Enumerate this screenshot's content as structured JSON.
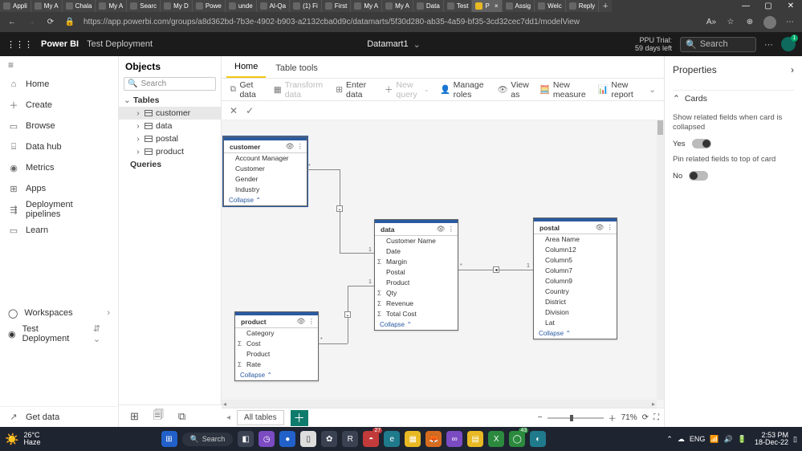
{
  "browser": {
    "tabs": [
      {
        "label": "Appli"
      },
      {
        "label": "My A"
      },
      {
        "label": "Chala"
      },
      {
        "label": "My A"
      },
      {
        "label": "Searc"
      },
      {
        "label": "My D"
      },
      {
        "label": "Powe"
      },
      {
        "label": "unde"
      },
      {
        "label": "Al-Qa"
      },
      {
        "label": "(1) Fi"
      },
      {
        "label": "First"
      },
      {
        "label": "My A"
      },
      {
        "label": "My A"
      },
      {
        "label": "Data"
      },
      {
        "label": "Test"
      },
      {
        "label": "P",
        "active": true
      },
      {
        "label": "Assig"
      },
      {
        "label": "Welc"
      },
      {
        "label": "Reply"
      }
    ],
    "url": "https://app.powerbi.com/groups/a8d362bd-7b3e-4902-b903-a2132cba0d9c/datamarts/5f30d280-ab35-4a59-bf35-3cd32cec7dd1/modelView"
  },
  "pbi_header": {
    "brand": "Power BI",
    "workspace": "Test Deployment",
    "datamart": "Datamart1",
    "trial_line1": "PPU Trial:",
    "trial_line2": "59 days left",
    "search_placeholder": "Search"
  },
  "sidebar": {
    "items": [
      {
        "icon": "⌂",
        "label": "Home"
      },
      {
        "icon": "＋",
        "label": "Create"
      },
      {
        "icon": "▭",
        "label": "Browse"
      },
      {
        "icon": "⌸",
        "label": "Data hub"
      },
      {
        "icon": "◉",
        "label": "Metrics"
      },
      {
        "icon": "⊞",
        "label": "Apps"
      },
      {
        "icon": "⇶",
        "label": "Deployment pipelines"
      },
      {
        "icon": "▭",
        "label": "Learn"
      }
    ],
    "workspaces_label": "Workspaces",
    "current_workspace": "Test Deployment",
    "getdata_label": "Get data"
  },
  "objects": {
    "title": "Objects",
    "search_placeholder": "Search",
    "tables_label": "Tables",
    "tables": [
      "customer",
      "data",
      "postal",
      "product"
    ],
    "selected": "customer",
    "queries_label": "Queries"
  },
  "tabs": {
    "items": [
      "Home",
      "Table tools"
    ],
    "active": "Home"
  },
  "ribbon": {
    "getdata": "Get data",
    "transform": "Transform data",
    "enter": "Enter data",
    "newquery": "New query",
    "roles": "Manage roles",
    "viewas": "View as",
    "measure": "New measure",
    "report": "New report"
  },
  "cards": {
    "customer": {
      "name": "customer",
      "fields": [
        "Account Manager",
        "Customer",
        "Gender",
        "Industry"
      ],
      "collapse": "Collapse"
    },
    "data": {
      "name": "data",
      "fields": [
        {
          "n": "Customer Name"
        },
        {
          "n": "Date"
        },
        {
          "n": "Margin",
          "sum": true
        },
        {
          "n": "Postal"
        },
        {
          "n": "Product"
        },
        {
          "n": "Qty",
          "sum": true
        },
        {
          "n": "Revenue",
          "sum": true
        },
        {
          "n": "Total Cost",
          "sum": true
        }
      ],
      "collapse": "Collapse"
    },
    "postal": {
      "name": "postal",
      "fields": [
        "Area Name",
        "Column12",
        "Column5",
        "Column7",
        "Column9",
        "Country",
        "District",
        "Division",
        "Lat"
      ],
      "collapse": "Collapse"
    },
    "product": {
      "name": "product",
      "fields": [
        {
          "n": "Category"
        },
        {
          "n": "Cost",
          "sum": true
        },
        {
          "n": "Product"
        },
        {
          "n": "Rate",
          "sum": true
        }
      ],
      "collapse": "Collapse"
    }
  },
  "zoom": {
    "alltables": "All tables",
    "pct": "71%"
  },
  "props": {
    "title": "Properties",
    "section_cards": "Cards",
    "opt1": "Show related fields when card is collapsed",
    "opt1_val": "Yes",
    "opt2": "Pin related fields to top of card",
    "opt2_val": "No"
  },
  "taskbar": {
    "temp": "26°C",
    "cond": "Haze",
    "search": "Search",
    "lang": "ENG",
    "time": "2:53 PM",
    "date": "18-Dec-22",
    "badge1": "27",
    "badge2": "43"
  }
}
